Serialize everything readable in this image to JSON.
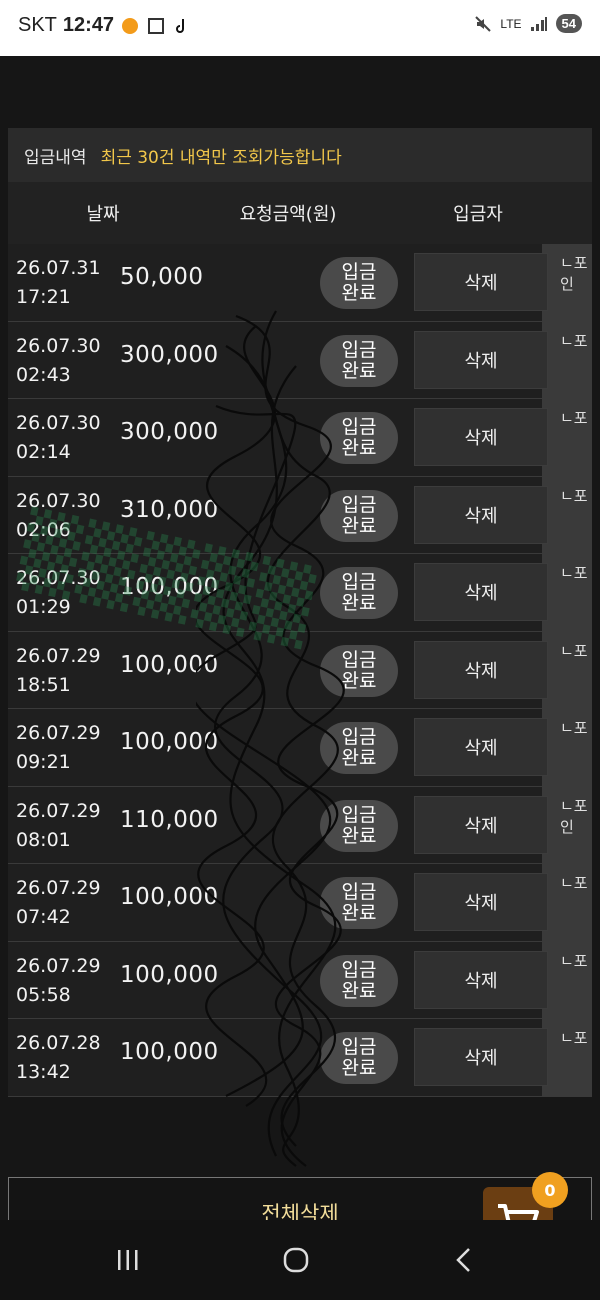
{
  "status_bar": {
    "carrier": "SKT",
    "time": "12:47",
    "network": "LTE",
    "battery": "54"
  },
  "panel": {
    "title": "입금내역",
    "note": "최근 30건 내역만 조회가능합니다"
  },
  "columns": {
    "date": "날짜",
    "amount": "요청금액(원)",
    "depositor": "입금자"
  },
  "status_label_line1": "입금",
  "status_label_line2": "완료",
  "delete_label": "삭제",
  "rows": [
    {
      "date": "26.07.31",
      "time": "17:21",
      "amount": "50,000",
      "point": "ㄴ포인"
    },
    {
      "date": "26.07.30",
      "time": "02:43",
      "amount": "300,000",
      "point": "ㄴ포"
    },
    {
      "date": "26.07.30",
      "time": "02:14",
      "amount": "300,000",
      "point": "ㄴ포"
    },
    {
      "date": "26.07.30",
      "time": "02:06",
      "amount": "310,000",
      "point": "ㄴ포"
    },
    {
      "date": "26.07.30",
      "time": "01:29",
      "amount": "100,000",
      "point": "ㄴ포"
    },
    {
      "date": "26.07.29",
      "time": "18:51",
      "amount": "100,000",
      "point": "ㄴ포"
    },
    {
      "date": "26.07.29",
      "time": "09:21",
      "amount": "100,000",
      "point": "ㄴ포"
    },
    {
      "date": "26.07.29",
      "time": "08:01",
      "amount": "110,000",
      "point": "ㄴ포인"
    },
    {
      "date": "26.07.29",
      "time": "07:42",
      "amount": "100,000",
      "point": "ㄴ포"
    },
    {
      "date": "26.07.29",
      "time": "05:58",
      "amount": "100,000",
      "point": "ㄴ포"
    },
    {
      "date": "26.07.28",
      "time": "13:42",
      "amount": "100,000",
      "point": "ㄴ포"
    }
  ],
  "delete_all_label": "전체삭제",
  "cart_badge": "0",
  "colors": {
    "accent_yellow": "#f2c74a",
    "cart_bg": "#6b3e12",
    "badge": "#f0a020"
  }
}
